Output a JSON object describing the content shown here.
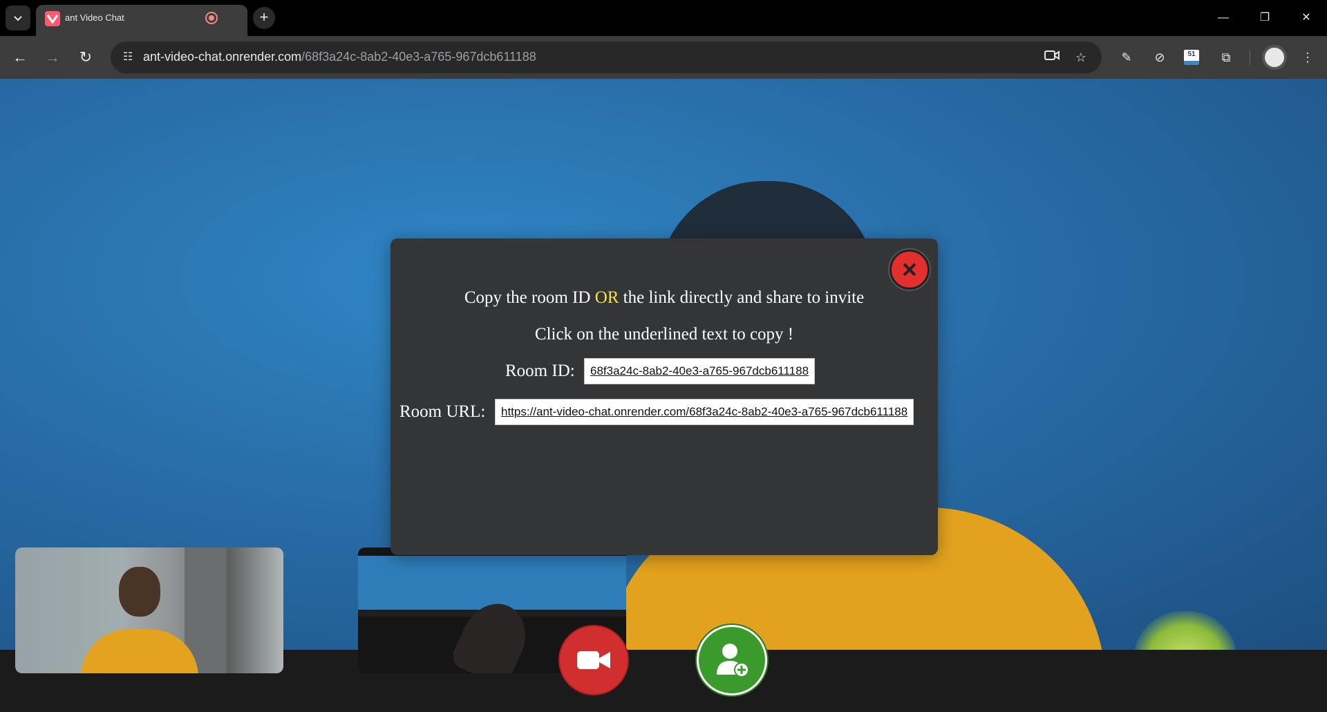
{
  "browser": {
    "tab": {
      "title": "ant Video Chat",
      "recording_icon": "record-indicator-icon",
      "close_icon": "close-icon"
    },
    "new_tab_icon": "plus-icon",
    "window_controls": [
      "minimize-icon",
      "restore-icon",
      "close-icon"
    ],
    "address_bar": {
      "url_host": "ant-video-chat.onrender.com",
      "url_path": "/68f3a24c-8ab2-40e3-a765-967dcb611188"
    },
    "toolbar_icons": [
      "back-icon",
      "forward-icon",
      "reload-icon",
      "camera-icon",
      "star-icon",
      "eyedropper-icon",
      "compass-icon",
      "extension-51-icon",
      "puzzle-icon",
      "profile-icon",
      "kebab-menu-icon"
    ],
    "extension_badge": "51"
  },
  "modal": {
    "line1_prefix": "Copy the room ID ",
    "line1_highlight": "OR",
    "line1_suffix": " the link directly and share to invite",
    "line2": "Click on the underlined text to copy !",
    "room_id_label": "Room ID:",
    "room_id_value": "68f3a24c-8ab2-40e3-a765-967dcb611188",
    "room_url_label": "Room URL:",
    "room_url_value": "https://ant-video-chat.onrender.com/68f3a24c-8ab2-40e3-a765-967dcb611188"
  },
  "colors": {
    "modal_bg": "#343536",
    "highlight": "#f6e14a",
    "close_red": "#e3302f",
    "video_btn_red": "#d12f2f",
    "invite_green": "#3a9a2b"
  }
}
